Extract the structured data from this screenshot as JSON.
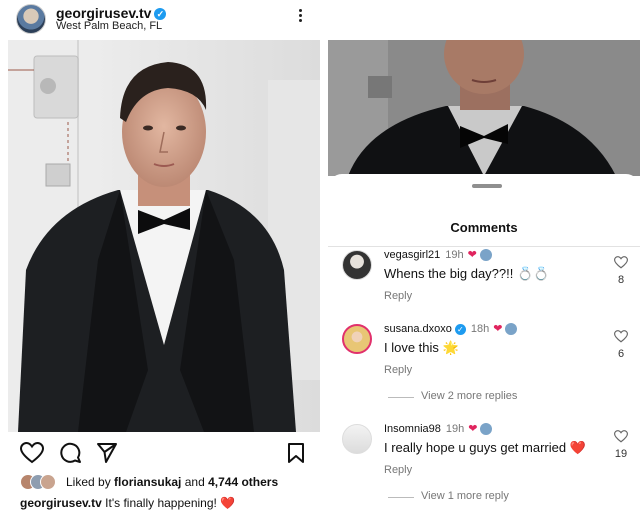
{
  "post": {
    "username": "georgirusev.tv",
    "location": "West Palm Beach, FL",
    "liked_by_prefix": "Liked by ",
    "liked_by_user": "floriansukaj",
    "liked_by_suffix": " and ",
    "liked_by_count": "4,744 others",
    "caption_user": "georgirusev.tv",
    "caption_text": " It's finally happening! ",
    "caption_emoji": "❤️"
  },
  "comments_sheet": {
    "title": "Comments",
    "comments": [
      {
        "user": "vegasgirl21",
        "time": "19h",
        "text": "Whens the big day??!! 💍💍",
        "reply": "Reply",
        "likes": "8"
      },
      {
        "user": "susana.dxoxo",
        "time": "18h",
        "text": "I love this 🌟",
        "reply": "Reply",
        "likes": "6"
      },
      {
        "user": "Insomnia98",
        "time": "19h",
        "text": "I really hope u guys get married ",
        "heart": "❤️",
        "reply": "Reply",
        "likes": "19"
      }
    ],
    "view_more_1": "View 2 more replies",
    "view_more_2": "View 1 more reply"
  },
  "colors": {
    "verified": "#1d9bf0",
    "heart": "#e0245e",
    "muted": "#777777"
  },
  "icons": [
    "verified-icon",
    "more-options-icon",
    "heart-icon",
    "comment-icon",
    "share-icon",
    "bookmark-icon",
    "comment-like-icon"
  ]
}
